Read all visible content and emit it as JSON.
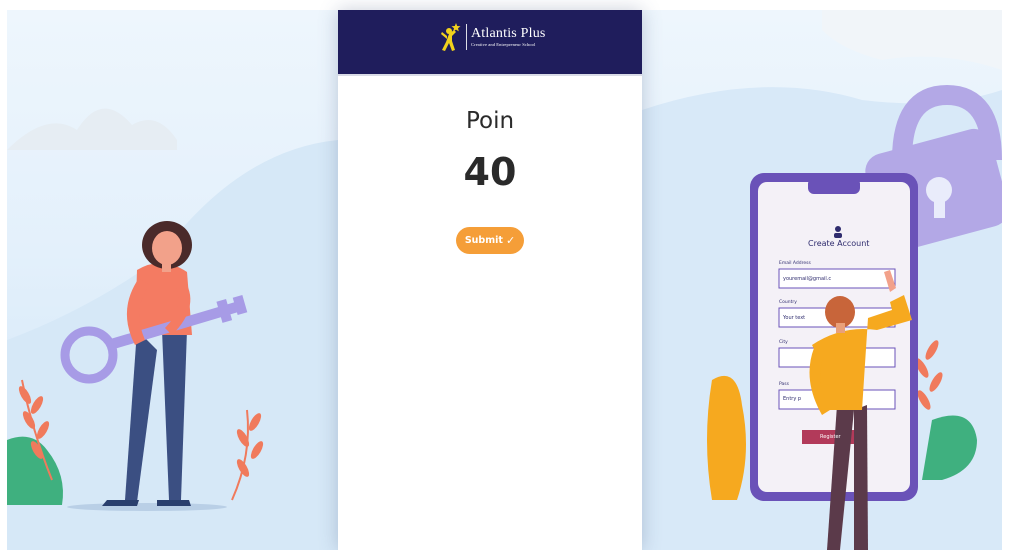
{
  "header": {
    "brand_name": "Atlantis Plus",
    "brand_tagline": "Creative and Entrepreneur School",
    "logo_icon": "person-star-logo-icon"
  },
  "main": {
    "points_label": "Poin",
    "points_value": "40",
    "submit_label": "Submit",
    "submit_icon": "✓"
  },
  "illustration_right": {
    "title": "Create Account",
    "fields": [
      {
        "label": "Email Address",
        "value": "youremail@gmail.c"
      },
      {
        "label": "Country",
        "value": "Your text"
      },
      {
        "label": "City",
        "value": ""
      },
      {
        "label": "Pass",
        "value": "Entry p"
      }
    ],
    "button_label": "Register"
  },
  "colors": {
    "header_bg": "#1f1d5c",
    "submit_bg": "#f59e38",
    "panel_bg": "#e3f0fb",
    "phone_frame": "#6a52b8",
    "lock": "#b3a8e6"
  }
}
